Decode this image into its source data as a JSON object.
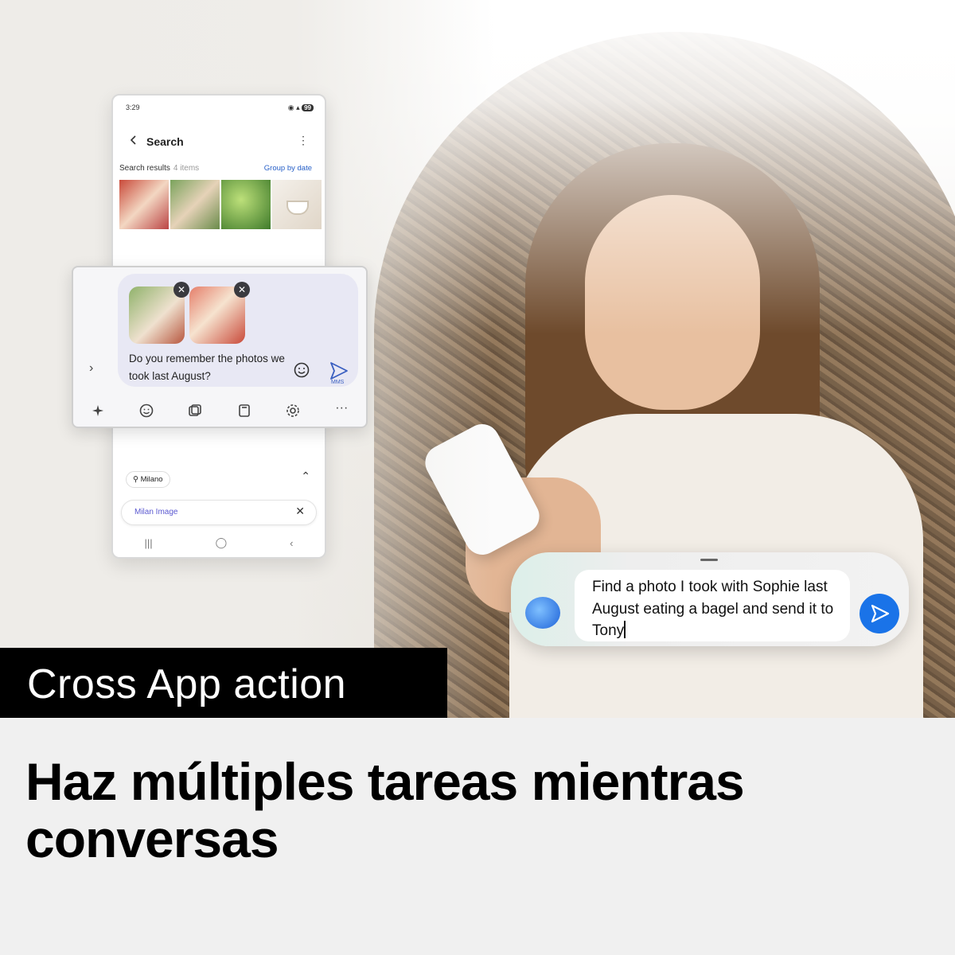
{
  "phone": {
    "status_time": "3:29",
    "status_battery": "99",
    "title": "Search",
    "results_label": "Search results",
    "results_count": "4 items",
    "group_by": "Group by date",
    "location_chip": "Milano",
    "field_text": "Milan Image"
  },
  "compose": {
    "message": "Do you remember the photos we took last August?",
    "send_sub": "MMS"
  },
  "assistant": {
    "prompt": "Find a photo I took with Sophie last August eating a bagel and send it to Tony"
  },
  "badge": "Cross App action",
  "headline": "Haz múltiples tareas mientras conversas",
  "colors": {
    "accent": "#1a73e8",
    "link": "#2860c8",
    "badge_bg": "#000000"
  }
}
